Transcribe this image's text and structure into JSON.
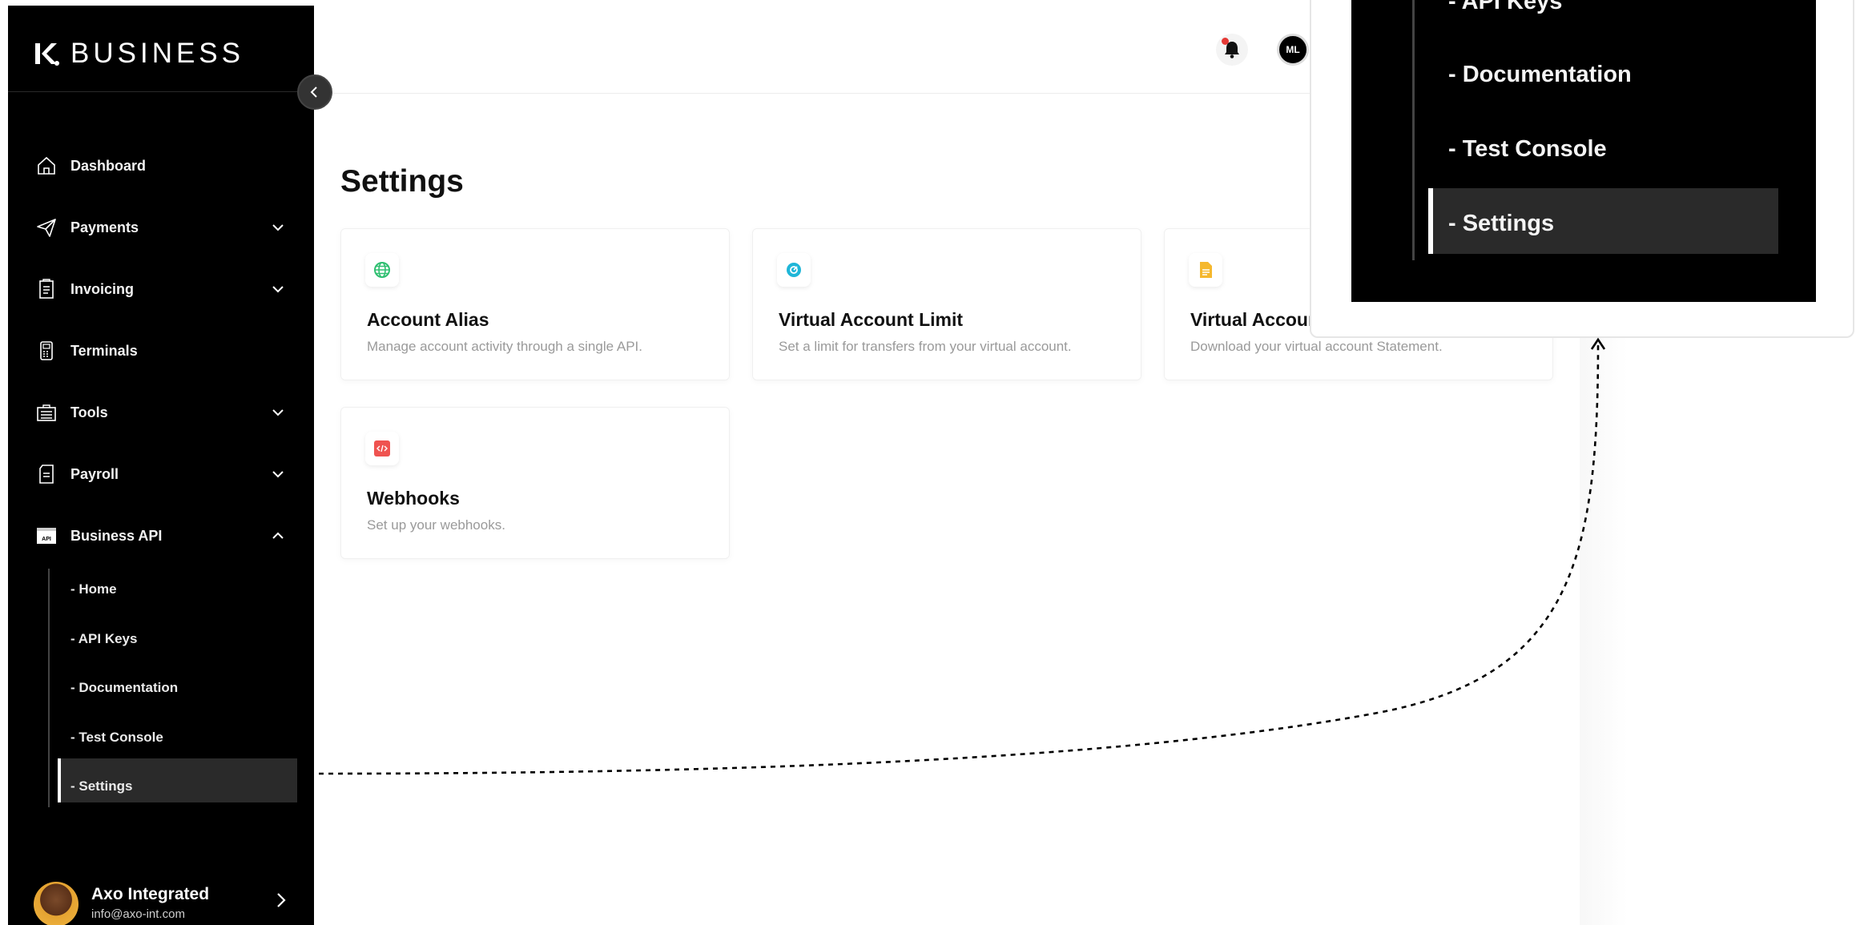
{
  "brand": {
    "logo_text": "BUSINESS"
  },
  "sidebar": {
    "items": [
      {
        "label": "Dashboard"
      },
      {
        "label": "Payments"
      },
      {
        "label": "Invoicing"
      },
      {
        "label": "Terminals"
      },
      {
        "label": "Tools"
      },
      {
        "label": "Payroll"
      },
      {
        "label": "Business API"
      }
    ],
    "api_icon_text": "API",
    "sub_items": [
      {
        "label": "- Home"
      },
      {
        "label": "- API Keys"
      },
      {
        "label": "- Documentation"
      },
      {
        "label": "- Test Console"
      },
      {
        "label": "- Settings"
      }
    ],
    "user": {
      "name": "Axo Integrated",
      "email": "info@axo-int.com"
    }
  },
  "topbar": {
    "avatar_initials": "ML"
  },
  "main": {
    "title": "Settings",
    "cards": [
      {
        "title": "Account Alias",
        "description": "Manage account activity through a single API."
      },
      {
        "title": "Virtual Account Limit",
        "description": "Set a limit for transfers from your virtual account."
      },
      {
        "title": "Virtual Account Statement",
        "description": "Download your virtual account Statement."
      },
      {
        "title": "Webhooks",
        "description": "Set up your webhooks."
      }
    ]
  },
  "zoom": {
    "items": [
      {
        "label": "- API Keys"
      },
      {
        "label": "- Documentation"
      },
      {
        "label": "- Test Console"
      },
      {
        "label": "- Settings"
      }
    ]
  },
  "colors": {
    "sidebar_bg": "#000000",
    "active_item_bg": "#2a2a2a",
    "notification_dot": "#e53935",
    "alias_icon": "#2fbf71",
    "limit_icon": "#1fb6d8",
    "statement_icon": "#f5b82e",
    "webhook_icon": "#ef5350"
  }
}
